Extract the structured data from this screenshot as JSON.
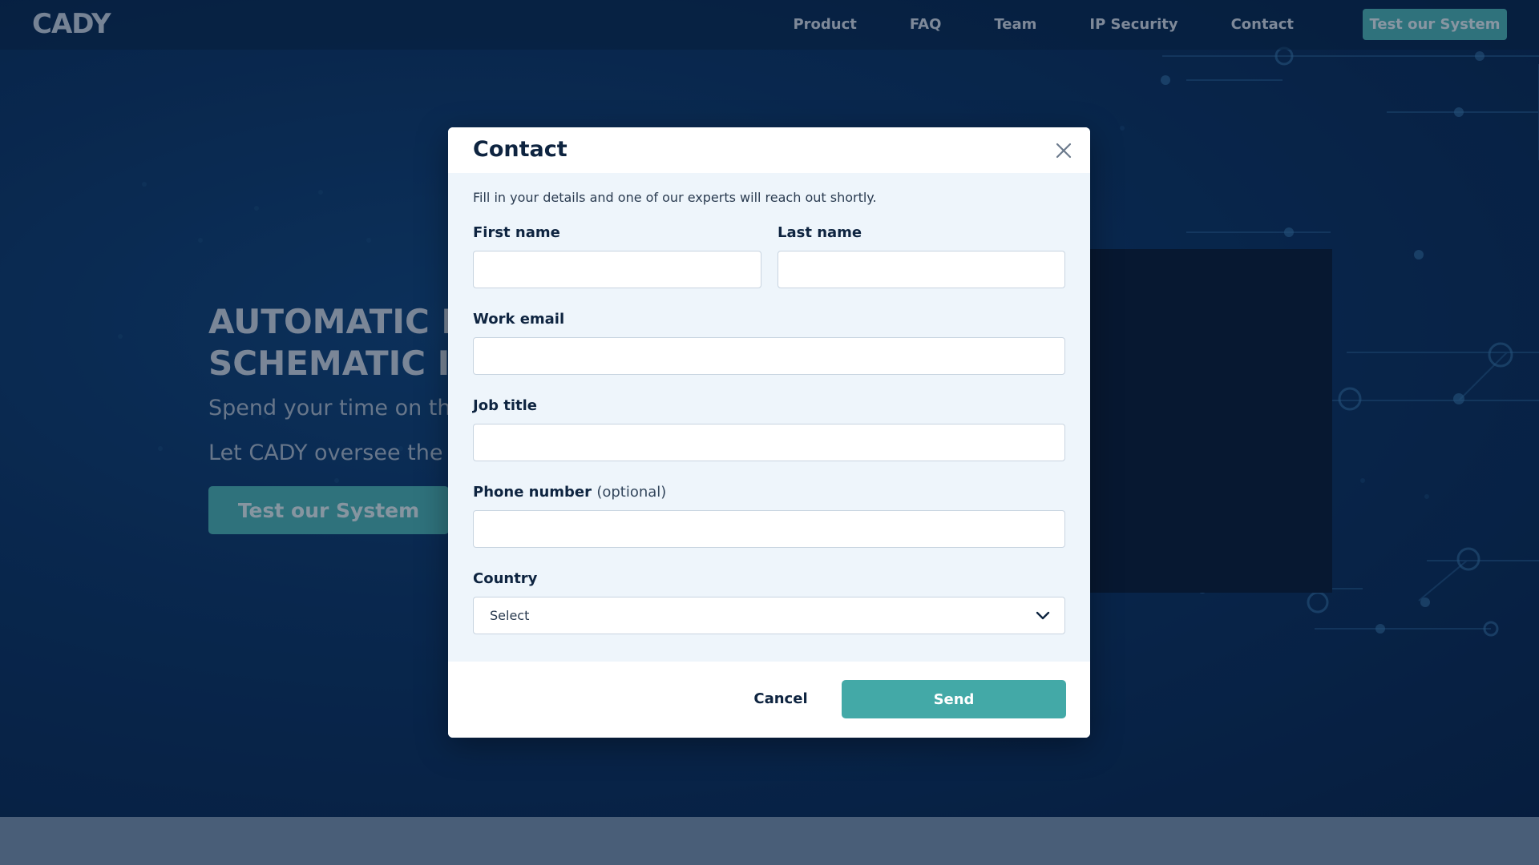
{
  "nav": {
    "logo": "CADY",
    "links": [
      "Product",
      "FAQ",
      "Team",
      "IP Security",
      "Contact"
    ],
    "cta_label": "Test our System"
  },
  "hero": {
    "title_line1": "AUTOMATIC EL",
    "title_line2": "SCHEMATIC IN",
    "sub_line1": "Spend your time on the",
    "sub_line2": "Let CADY oversee the tec",
    "cta_label": "Test our System"
  },
  "modal": {
    "title": "Contact",
    "intro": "Fill in your details and one of our experts will reach out shortly.",
    "fields": {
      "first_name": {
        "label": "First name",
        "value": ""
      },
      "last_name": {
        "label": "Last name",
        "value": ""
      },
      "work_email": {
        "label": "Work email",
        "value": ""
      },
      "job_title": {
        "label": "Job title",
        "value": ""
      },
      "phone": {
        "label": "Phone number",
        "optional_note": "(optional)",
        "value": ""
      },
      "country": {
        "label": "Country",
        "selected": "Select"
      }
    },
    "cancel_label": "Cancel",
    "send_label": "Send"
  },
  "icons": {
    "close": "close-icon",
    "dropdown": "chevron-down-icon"
  },
  "colors": {
    "accent": "#43a9a7",
    "navy": "#0e2440",
    "background": "#0a2a52"
  }
}
